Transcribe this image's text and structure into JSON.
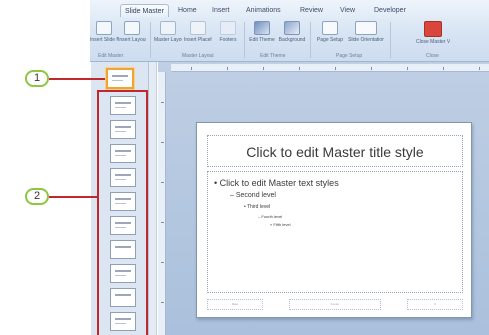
{
  "ribbon": {
    "tabs": [
      {
        "label": "Slide Master",
        "active": true
      },
      {
        "label": "Home",
        "active": false
      },
      {
        "label": "Insert",
        "active": false
      },
      {
        "label": "Animations",
        "active": false
      },
      {
        "label": "Review",
        "active": false
      },
      {
        "label": "View",
        "active": false
      },
      {
        "label": "Developer",
        "active": false
      }
    ],
    "buttons": [
      {
        "label": "Insert Slide Master",
        "icon": "insert-slide-master-icon"
      },
      {
        "label": "Insert Layout",
        "icon": "insert-layout-icon"
      },
      {
        "label": "Master Layout",
        "icon": "master-layout-icon"
      },
      {
        "label": "Insert Placeholder",
        "icon": "insert-placeholder-icon"
      },
      {
        "label": "Footers",
        "icon": "footers-icon"
      },
      {
        "label": "Edit Theme",
        "icon": "themes-icon"
      },
      {
        "label": "Background",
        "icon": "background-icon"
      },
      {
        "label": "Page Setup",
        "icon": "page-setup-icon"
      },
      {
        "label": "Slide Orientation",
        "icon": "slide-orientation-icon"
      },
      {
        "label": "Close Master View",
        "icon": "close-master-view-icon"
      }
    ],
    "groups": [
      "Edit Master",
      "Master Layout",
      "Edit Theme",
      "Page Setup",
      "Close"
    ]
  },
  "slide": {
    "title": "Click to edit Master title style",
    "levels": [
      "Click to edit Master text styles",
      "Second level",
      "Third level",
      "Fourth level",
      "Fifth level"
    ],
    "footers": [
      "Date",
      "Footer",
      "#"
    ]
  },
  "callouts": [
    {
      "number": "1"
    },
    {
      "number": "2"
    }
  ],
  "colors": {
    "callout_border": "#8dc63f",
    "callout_line": "#c0282d",
    "master_highlight": "#f0a436",
    "close_button": "#d9463b"
  }
}
